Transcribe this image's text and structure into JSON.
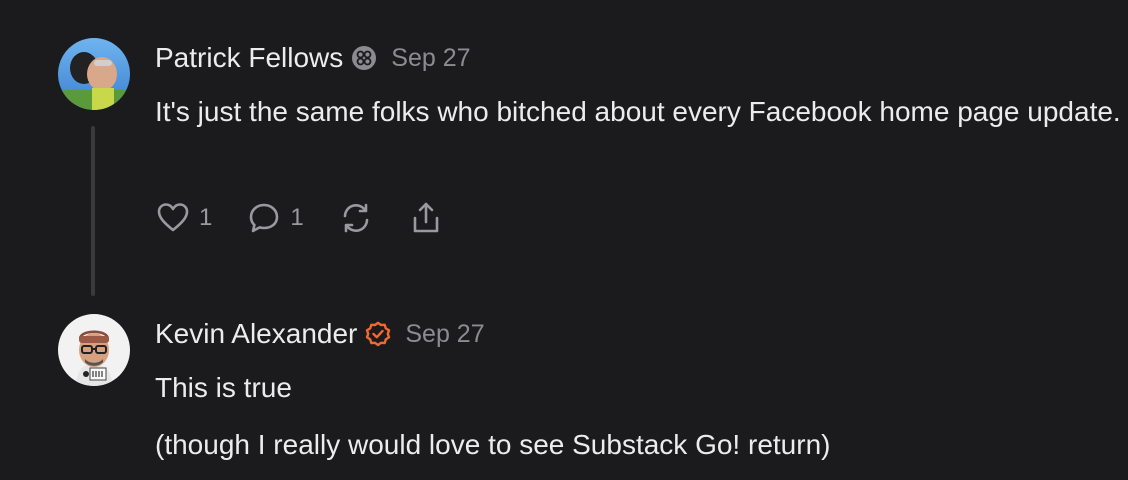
{
  "comments": [
    {
      "author": "Patrick Fellows",
      "badge_icon": "subscriber-badge-icon",
      "date": "Sep 27",
      "paragraphs": [
        "It's just the same folks who bitched about every Facebook home page update."
      ],
      "actions": {
        "like_icon": "heart-icon",
        "like_count": "1",
        "reply_icon": "comment-bubble-icon",
        "reply_count": "1",
        "restack_icon": "restack-icon",
        "share_icon": "share-icon"
      }
    },
    {
      "author": "Kevin Alexander",
      "badge_icon": "verified-check-icon",
      "badge_color": "#f26a2e",
      "date": "Sep 27",
      "paragraphs": [
        "This is true",
        "(though I really would love to see Substack Go! return)"
      ]
    }
  ],
  "colors": {
    "background": "#1b1b1d",
    "text": "#ececec",
    "muted": "#8c8c90",
    "accent": "#f26a2e"
  }
}
